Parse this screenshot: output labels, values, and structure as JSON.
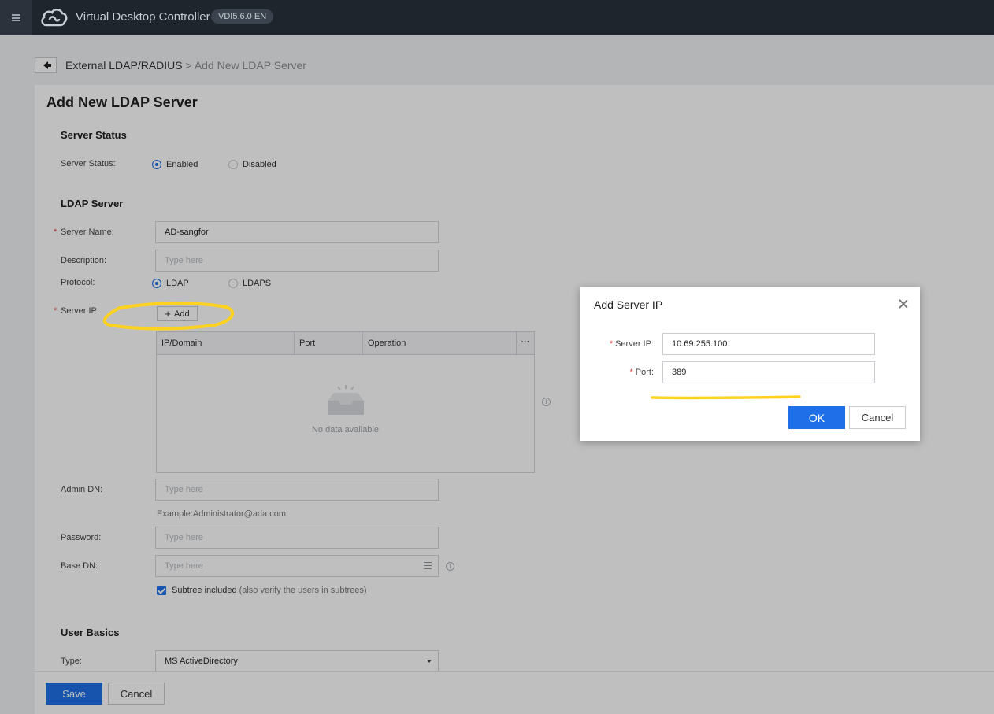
{
  "header": {
    "app_title": "Virtual Desktop Controller",
    "version": "VDI5.6.0 EN"
  },
  "breadcrumb": {
    "parent": "External LDAP/RADIUS",
    "separator": ">",
    "current": "Add New LDAP Server"
  },
  "page": {
    "title": "Add New LDAP Server",
    "server_status_section": "Server Status",
    "server_status_label": "Server Status:",
    "status_options": [
      "Enabled",
      "Disabled"
    ],
    "status_selected": "Enabled",
    "ldap_section": "LDAP Server",
    "server_name_label": "Server Name:",
    "server_name_value": "AD-sangfor",
    "description_label": "Description:",
    "description_placeholder": "Type here",
    "protocol_label": "Protocol:",
    "protocol_options": [
      "LDAP",
      "LDAPS"
    ],
    "protocol_selected": "LDAP",
    "server_ip_label": "Server IP:",
    "add_label": "Add",
    "table": {
      "columns": [
        "IP/Domain",
        "Port",
        "Operation"
      ],
      "more": "···",
      "empty_text": "No data available"
    },
    "admin_dn_label": "Admin DN:",
    "admin_dn_placeholder": "Type here",
    "admin_dn_hint": "Example:Administrator@ada.com",
    "password_label": "Password:",
    "password_placeholder": "Type here",
    "base_dn_label": "Base DN:",
    "base_dn_placeholder": "Type here",
    "subtree_label": "Subtree included",
    "subtree_hint": "(also verify the users in subtrees)",
    "subtree_checked": true,
    "user_basics_section": "User Basics",
    "type_label": "Type:",
    "type_value": "MS ActiveDirectory",
    "info_glyph": "i"
  },
  "footer": {
    "save_label": "Save",
    "cancel_label": "Cancel"
  },
  "dialog": {
    "title": "Add Server IP",
    "server_ip_label": "Server IP:",
    "server_ip_value": "10.69.255.100",
    "port_label": "Port:",
    "port_value": "389",
    "ok_label": "OK",
    "cancel_label": "Cancel"
  },
  "colors": {
    "primary": "#1f70e8",
    "topbar": "#1f252d",
    "annotation": "#ffd21f"
  }
}
